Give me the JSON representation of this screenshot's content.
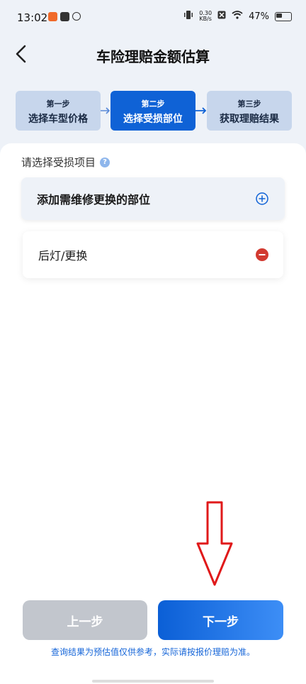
{
  "status_bar": {
    "time": "13:02",
    "net_speed_value": "0.30",
    "net_speed_unit": "KB/s",
    "battery": "47%"
  },
  "header": {
    "title": "车险理赔金额估算"
  },
  "steps": [
    {
      "label": "第一步",
      "title": "选择车型价格",
      "active": false
    },
    {
      "label": "第二步",
      "title": "选择受损部位",
      "active": true
    },
    {
      "label": "第三步",
      "title": "获取理赔结果",
      "active": false
    }
  ],
  "section": {
    "title": "请选择受损项目",
    "help_glyph": "?"
  },
  "add_part": {
    "label": "添加需维修更换的部位"
  },
  "items": [
    {
      "label": "后灯/更换"
    }
  ],
  "buttons": {
    "prev": "上一步",
    "next": "下一步"
  },
  "disclaimer": "查询结果为预估值仅供参考，实际请按报价理赔为准。",
  "colors": {
    "accent": "#0f62d6",
    "danger": "#d23a30",
    "annotation": "#e0191a"
  }
}
